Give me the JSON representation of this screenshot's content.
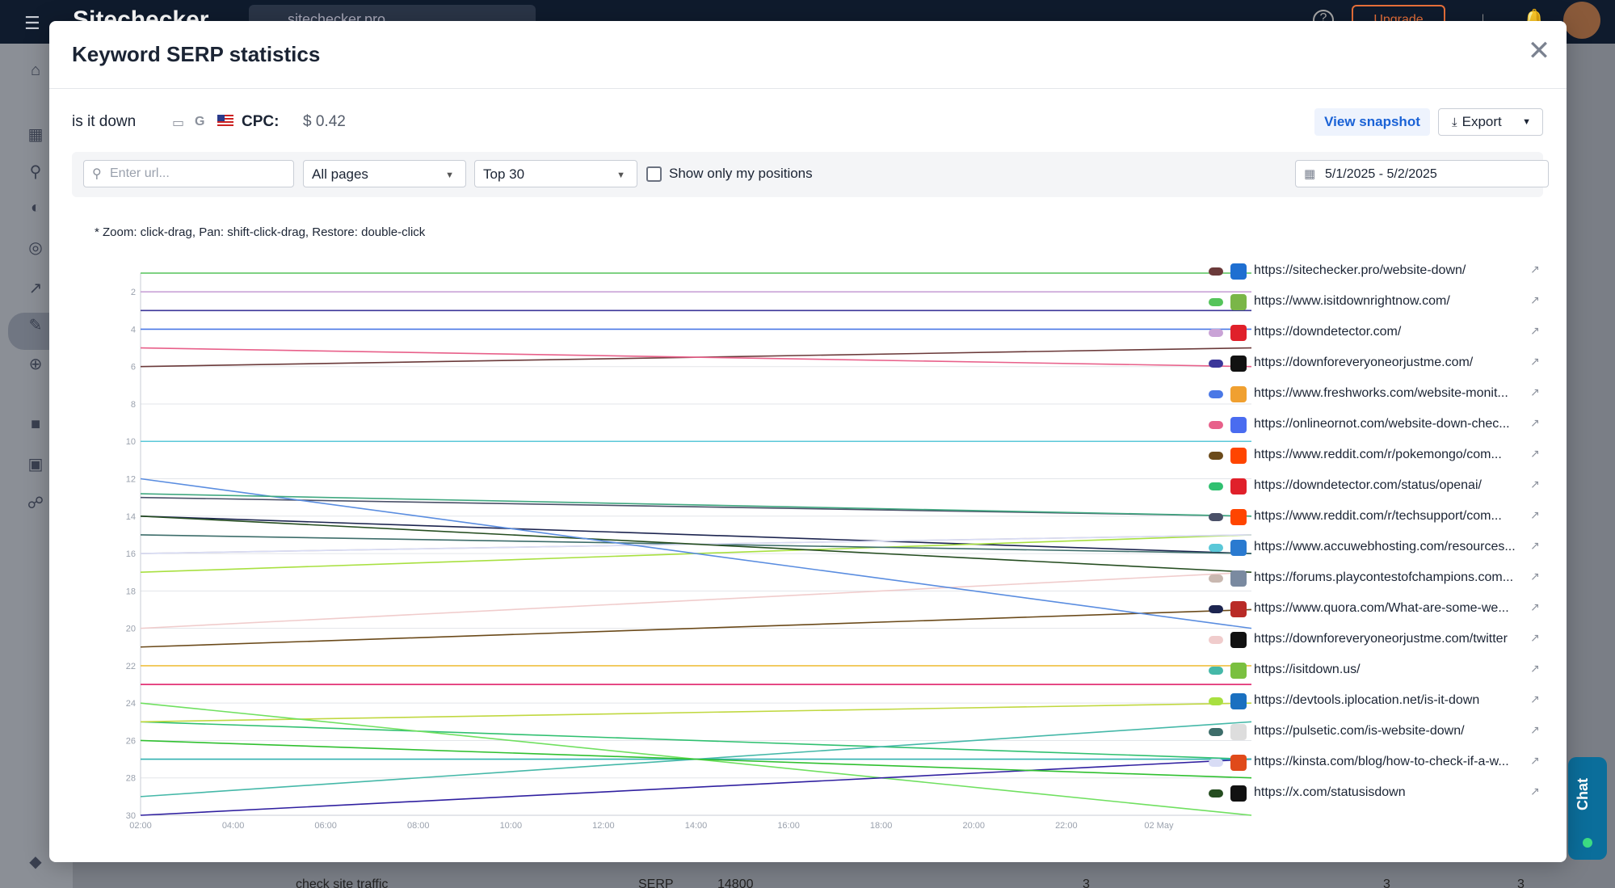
{
  "background": {
    "logo": "Sitechecker",
    "project": "sitechecker.pro",
    "upgrade_label": "Upgrade",
    "bottom_row": {
      "keyword": "check site traffic",
      "serp_label": "SERP",
      "volume": "14800",
      "pos_a": "3",
      "pos_b": "3",
      "pos_c": "3"
    }
  },
  "chat": {
    "label": "Chat"
  },
  "modal": {
    "title": "Keyword SERP statistics",
    "keyword": "is it down",
    "cpc_label": "CPC:",
    "cpc_value": "$ 0.42",
    "view_snapshot_label": "View snapshot",
    "export_label": "Export"
  },
  "filters": {
    "search_placeholder": "Enter url...",
    "pages_select": "All pages",
    "top_select": "Top 30",
    "my_positions_label": "Show only my positions",
    "date_range": "5/1/2025 - 5/2/2025"
  },
  "chart_note": "* Zoom: click-drag, Pan: shift-click-drag, Restore: double-click",
  "chart_data": {
    "type": "line",
    "x": [
      "02:00",
      "04:00",
      "06:00",
      "08:00",
      "10:00",
      "12:00",
      "14:00",
      "16:00",
      "18:00",
      "20:00",
      "22:00",
      "02 May"
    ],
    "y_ticks": [
      2,
      4,
      6,
      8,
      10,
      12,
      14,
      16,
      18,
      20,
      22,
      24,
      26,
      28,
      30
    ],
    "ylim": [
      1,
      30
    ],
    "y_inverted": true,
    "grid": true,
    "series": [
      {
        "name": "https://sitechecker.pro/website-down/",
        "color": "#6b3a3a",
        "start": 6,
        "end": 5,
        "fav": "#1f6fd1"
      },
      {
        "name": "https://www.isitdownrightnow.com/",
        "color": "#55c45a",
        "start": 1,
        "end": 1,
        "fav": "#7ab648"
      },
      {
        "name": "https://downdetector.com/",
        "color": "#c9a3d6",
        "start": 2,
        "end": 2,
        "fav": "#e0202a"
      },
      {
        "name": "https://downforeveryoneorjustme.com/",
        "color": "#3b3699",
        "start": 3,
        "end": 3,
        "fav": "#111111"
      },
      {
        "name": "https://www.freshworks.com/website-monit...",
        "color": "#4a78e6",
        "start": 4,
        "end": 4,
        "fav": "#f0a030"
      },
      {
        "name": "https://onlineornot.com/website-down-chec...",
        "color": "#e8608a",
        "start": 5,
        "end": 6,
        "fav": "#4a6cf0"
      },
      {
        "name": "https://www.reddit.com/r/pokemongo/com...",
        "color": "#6b4a1a",
        "start": 21,
        "end": 19,
        "fav": "#ff4500"
      },
      {
        "name": "https://downdetector.com/status/openai/",
        "color": "#30c070",
        "start": 25,
        "end": 27,
        "fav": "#e0202a"
      },
      {
        "name": "https://www.reddit.com/r/techsupport/com...",
        "color": "#4a5068",
        "start": 13,
        "end": 14,
        "fav": "#ff4500"
      },
      {
        "name": "https://www.accuwebhosting.com/resources...",
        "color": "#5ac8d8",
        "start": 10,
        "end": 10,
        "fav": "#2a7ad0"
      },
      {
        "name": "https://forums.playcontestofchampions.com...",
        "color": "#c9b8b0",
        "start": 16,
        "end": 15,
        "fav": "#7a8aa0"
      },
      {
        "name": "https://www.quora.com/What-are-some-we...",
        "color": "#1d2550",
        "start": 14,
        "end": 16,
        "fav": "#b92b27"
      },
      {
        "name": "https://downforeveryoneorjustme.com/twitter",
        "color": "#f0cccc",
        "start": 20,
        "end": 17,
        "fav": "#111111"
      },
      {
        "name": "https://isitdown.us/",
        "color": "#45b8a8",
        "start": 29,
        "end": 25,
        "fav": "#7ac040"
      },
      {
        "name": "https://devtools.iplocation.net/is-it-down",
        "color": "#a8e040",
        "start": 17,
        "end": 15,
        "fav": "#1a70c0"
      },
      {
        "name": "https://pulsetic.com/is-website-down/",
        "color": "#3d6d6a",
        "start": 15,
        "end": 16,
        "fav": "#dddddd"
      },
      {
        "name": "https://kinsta.com/blog/how-to-check-if-a-w...",
        "color": "#d8dcf5",
        "start": 16,
        "end": 15,
        "fav": "#e04a1a"
      },
      {
        "name": "https://x.com/statusisdown",
        "color": "#254d20",
        "start": 14,
        "end": 17,
        "fav": "#111111"
      }
    ],
    "extra_lines": [
      {
        "color": "#5a8de0",
        "start": 12,
        "end": 20
      },
      {
        "color": "#f0c040",
        "start": 22,
        "end": 22
      },
      {
        "color": "#e0206a",
        "start": 23,
        "end": 23
      },
      {
        "color": "#c0d840",
        "start": 25,
        "end": 24
      },
      {
        "color": "#70e060",
        "start": 24,
        "end": 30
      },
      {
        "color": "#3020a0",
        "start": 30,
        "end": 27
      },
      {
        "color": "#30b0b0",
        "start": 27,
        "end": 27
      },
      {
        "color": "#40a880",
        "start": 12.8,
        "end": 14
      },
      {
        "color": "#30c030",
        "start": 26,
        "end": 28
      }
    ]
  }
}
